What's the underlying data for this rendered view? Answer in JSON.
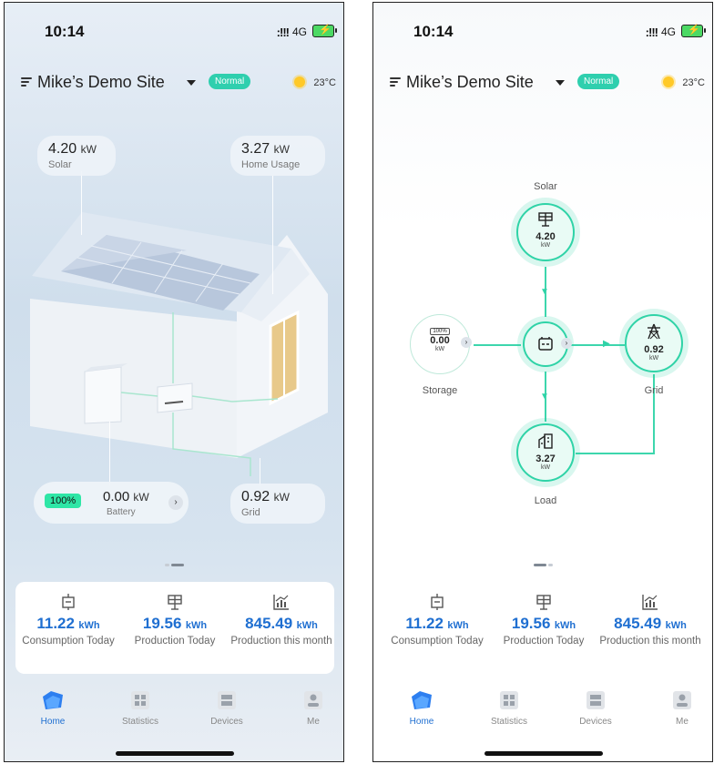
{
  "status_bar": {
    "time": "10:14",
    "signal": ":!!!",
    "network": "4G"
  },
  "header": {
    "site_name": "Mike’s Demo Site",
    "status": "Normal",
    "temperature": "23°C"
  },
  "house_view": {
    "solar": {
      "value": "4.20",
      "unit": "kW",
      "label": "Solar"
    },
    "home_usage": {
      "value": "3.27",
      "unit": "kW",
      "label": "Home Usage"
    },
    "battery": {
      "percent": "100%",
      "value": "0.00",
      "unit": "kW",
      "label": "Battery"
    },
    "grid": {
      "value": "0.92",
      "unit": "kW",
      "label": "Grid"
    }
  },
  "flow_view": {
    "solar": {
      "caption": "Solar",
      "value": "4.20",
      "unit": "kW"
    },
    "storage": {
      "caption": "Storage",
      "value": "0.00",
      "unit": "kW",
      "percent": "100%"
    },
    "grid": {
      "caption": "Grid",
      "value": "0.92",
      "unit": "kW"
    },
    "load": {
      "caption": "Load",
      "value": "3.27",
      "unit": "kW"
    }
  },
  "stats": [
    {
      "value": "11.22",
      "unit": "kWh",
      "label": "Consumption Today",
      "icon": "consumption-icon"
    },
    {
      "value": "19.56",
      "unit": "kWh",
      "label": "Production Today",
      "icon": "solar-panel-icon"
    },
    {
      "value": "845.49",
      "unit": "kWh",
      "label": "Production this month",
      "icon": "chart-icon"
    }
  ],
  "nav": [
    {
      "label": "Home",
      "active": true
    },
    {
      "label": "Statistics",
      "active": false
    },
    {
      "label": "Devices",
      "active": false
    },
    {
      "label": "Me",
      "active": false
    }
  ],
  "colors": {
    "accent": "#2fd3a7",
    "value_blue": "#1f6fd1",
    "status_pill": "#2fcfae"
  }
}
